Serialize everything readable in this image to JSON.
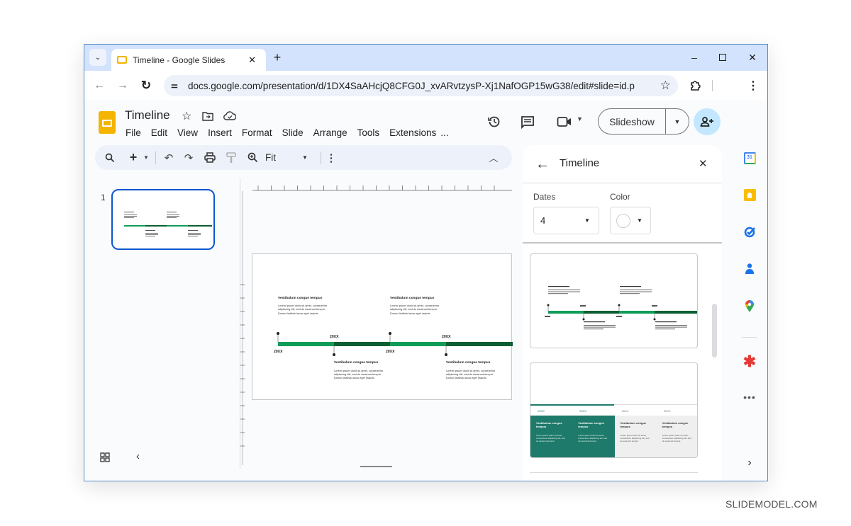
{
  "browser": {
    "tab_title": "Timeline - Google Slides",
    "url": "docs.google.com/presentation/d/1DX4SaAHcjQ8CFG0J_xvARvtzysP-Xj1NafOGP15wG38/edit#slide=id.p",
    "icons": {
      "tab_search": "chevron-down-icon",
      "new_tab": "plus-icon",
      "back": "arrow-left-icon",
      "forward": "arrow-right-icon",
      "reload": "reload-icon",
      "site_info": "tune-icon",
      "bookmark": "star-icon",
      "extensions": "puzzle-icon",
      "menu": "more-vert-icon"
    },
    "window_controls": {
      "minimize": "–",
      "maximize": "☐",
      "close": "✕"
    }
  },
  "app": {
    "doc_title": "Timeline",
    "menu": [
      "File",
      "Edit",
      "View",
      "Insert",
      "Format",
      "Slide",
      "Arrange",
      "Tools",
      "Extensions",
      "..."
    ],
    "slideshow_label": "Slideshow",
    "toolbar": {
      "zoom_value": "Fit"
    }
  },
  "filmstrip": {
    "slide_number": "1"
  },
  "slide": {
    "events": [
      {
        "title": "Vestibulum congue tempus",
        "body": [
          "Lorem ipsum dolor sit amet, consectetur",
          "adipiscing elit, sed do eiusmod tempor.",
          "Donec facilisis lacus eget mauris."
        ],
        "date": "20XX",
        "position": "above"
      },
      {
        "title": "Vestibulum congue tempus",
        "body": [
          "Lorem ipsum dolor sit amet, consectetur",
          "adipiscing elit, sed do eiusmod tempor.",
          "Donec facilisis lacus eget mauris."
        ],
        "date": "20XX",
        "position": "below"
      },
      {
        "title": "Vestibulum congue tempus",
        "body": [
          "Lorem ipsum dolor sit amet, consectetur",
          "adipiscing elit, sed do eiusmod tempor.",
          "Donec facilisis lacus eget mauris."
        ],
        "date": "20XX",
        "position": "above"
      },
      {
        "title": "Vestibulum congue tempus",
        "body": [
          "Lorem ipsum dolor sit amet, consectetur",
          "adipiscing elit, sed do eiusmod tempor.",
          "Donec facilisis lacus eget mauris."
        ],
        "date": "20XX",
        "position": "below"
      }
    ],
    "colors": {
      "light_green": "#0f9d58",
      "dark_green": "#0b5f33"
    }
  },
  "panel": {
    "title": "Timeline",
    "dates_label": "Dates",
    "dates_value": "4",
    "color_label": "Color",
    "template2": {
      "dates": [
        "20XX",
        "20XX",
        "20XX",
        "20XX"
      ],
      "title": "Vestibulum congue tempus",
      "body": "Lorem ipsum dolor sit amet, consectetur adipiscing elit, sed do eiusmod tempor.",
      "teal": "#1e7a6a"
    }
  },
  "side_apps": [
    "calendar-icon",
    "keep-icon",
    "tasks-icon",
    "contacts-icon",
    "maps-icon",
    "asterisk-addon-icon",
    "more-horiz-icon"
  ],
  "calendar_day": "31",
  "watermark": "SLIDEMODEL.COM"
}
